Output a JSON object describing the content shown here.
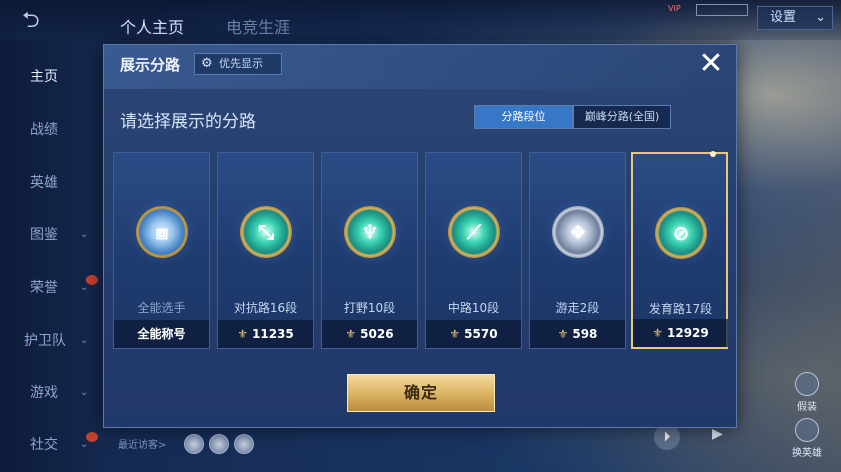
{
  "top": {
    "tabs": [
      "个人主页",
      "电竞生涯"
    ],
    "settings_label": "设置",
    "vip": "VIP"
  },
  "sidebar": {
    "items": [
      {
        "label": "主页"
      },
      {
        "label": "战绩"
      },
      {
        "label": "英雄"
      },
      {
        "label": "图鉴"
      },
      {
        "label": "荣誉"
      },
      {
        "label": "护卫队"
      },
      {
        "label": "游戏"
      },
      {
        "label": "社交"
      }
    ],
    "recent_visitors_label": "最近访客>"
  },
  "right_buttons": [
    "假装",
    "换英雄"
  ],
  "modal": {
    "title": "展示分路",
    "priority_label": "优先显示",
    "close_glyph": "✕",
    "prompt": "请选择展示的分路",
    "segments": [
      "分路段位",
      "巅峰分路(全国)"
    ],
    "cards": [
      {
        "label": "全能选手",
        "footer": "全能称号",
        "has_coin": false,
        "emblem": "all-round-emblem-icon",
        "glyph": "⧈"
      },
      {
        "label": "对抗路16段",
        "footer": "11235",
        "has_coin": true,
        "emblem": "clash-lane-emblem-icon",
        "glyph": "⤡"
      },
      {
        "label": "打野10段",
        "footer": "5026",
        "has_coin": true,
        "emblem": "jungle-emblem-icon",
        "glyph": "♆"
      },
      {
        "label": "中路10段",
        "footer": "5570",
        "has_coin": true,
        "emblem": "mid-lane-emblem-icon",
        "glyph": "⟋"
      },
      {
        "label": "游走2段",
        "footer": "598",
        "has_coin": true,
        "emblem": "roam-emblem-icon",
        "glyph": "❖"
      },
      {
        "label": "发育路17段",
        "footer": "12929",
        "has_coin": true,
        "emblem": "farm-lane-emblem-icon",
        "glyph": "⊘"
      }
    ],
    "selected_index": 5,
    "confirm_label": "确定"
  },
  "colors": {
    "accent": "#3678c7",
    "gold": "#ddb665",
    "modal_bg": "#26406e"
  }
}
